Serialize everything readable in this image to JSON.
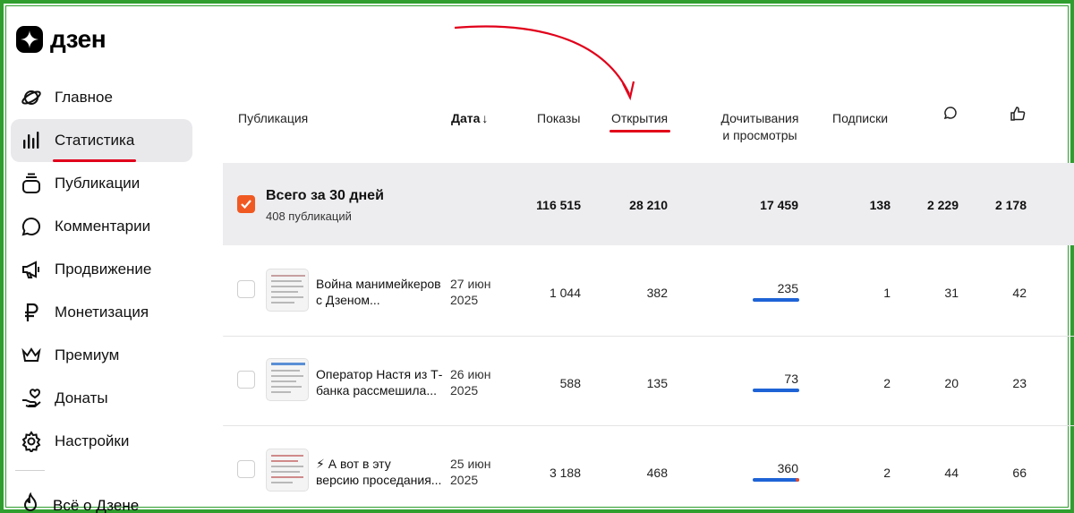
{
  "app": {
    "logo_text": "дзен"
  },
  "sidebar": {
    "items": [
      {
        "label": "Главное",
        "icon": "planet-icon"
      },
      {
        "label": "Статистика",
        "icon": "bar-chart-icon",
        "active": true
      },
      {
        "label": "Публикации",
        "icon": "stack-icon"
      },
      {
        "label": "Комментарии",
        "icon": "comment-icon"
      },
      {
        "label": "Продвижение",
        "icon": "megaphone-icon"
      },
      {
        "label": "Монетизация",
        "icon": "ruble-icon"
      },
      {
        "label": "Премиум",
        "icon": "crown-icon"
      },
      {
        "label": "Донаты",
        "icon": "donate-hand-icon"
      },
      {
        "label": "Настройки",
        "icon": "gear-icon"
      }
    ],
    "bottom_item": "Всё о Дзене"
  },
  "table": {
    "headers": {
      "publication": "Публикация",
      "date": "Дата",
      "shows": "Показы",
      "opens": "Открытия",
      "reads_line1": "Дочитывания",
      "reads_line2": "и просмотры",
      "subs": "Подписки",
      "comments_icon": "comment-icon",
      "likes_icon": "thumb-up-icon"
    },
    "totals": {
      "title": "Всего за 30 дней",
      "subtitle": "408 публикаций",
      "shows": "116 515",
      "opens": "28 210",
      "reads": "17 459",
      "subs": "138",
      "comments": "2 229",
      "likes": "2 178"
    },
    "rows": [
      {
        "title_line1": "Война манимейкеров",
        "title_line2": "с Дзеном...",
        "date_line1": "27 июн",
        "date_line2": "2025",
        "shows": "1 044",
        "opens": "382",
        "reads": "235",
        "reads_fraction": 1.0,
        "subs": "1",
        "comments": "31",
        "likes": "42"
      },
      {
        "title_line1": "Оператор Настя из Т-",
        "title_line2": "банка рассмешила...",
        "date_line1": "26 июн",
        "date_line2": "2025",
        "shows": "588",
        "opens": "135",
        "reads": "73",
        "reads_fraction": 1.0,
        "subs": "2",
        "comments": "20",
        "likes": "23"
      },
      {
        "title_line1": "⚡ А вот в эту",
        "title_line2": "версию проседания...",
        "date_line1": "25 июн",
        "date_line2": "2025",
        "shows": "3 188",
        "opens": "468",
        "reads": "360",
        "reads_fraction": 1.0,
        "subs": "2",
        "comments": "44",
        "likes": "66"
      }
    ]
  },
  "colors": {
    "accent_orange": "#f05a22",
    "bar_blue": "#1e63d6",
    "annotation_red": "#e1001a",
    "frame_green": "#2f9e2f"
  }
}
